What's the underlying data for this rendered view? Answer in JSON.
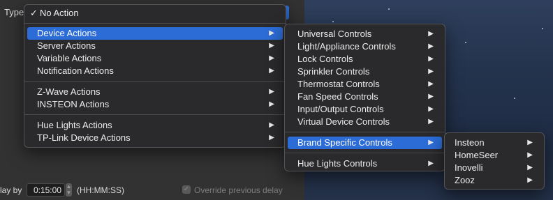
{
  "window": {
    "type_label": "Type",
    "delay_label": "lay by",
    "delay_value": "0:15:00",
    "delay_format": "(HH:MM:SS)",
    "override_label": "Override previous delay"
  },
  "main_menu": {
    "checked_item": "No Action",
    "check_glyph": "✓",
    "groups": [
      [
        "Device Actions",
        "Server Actions",
        "Variable Actions",
        "Notification Actions"
      ],
      [
        "Z-Wave Actions",
        "INSTEON Actions"
      ],
      [
        "Hue Lights Actions",
        "TP-Link Device Actions"
      ]
    ],
    "selected": "Device Actions"
  },
  "device_menu": {
    "groups": [
      [
        "Universal Controls",
        "Light/Appliance Controls",
        "Lock Controls",
        "Sprinkler Controls",
        "Thermostat Controls",
        "Fan Speed Controls",
        "Input/Output Controls",
        "Virtual Device Controls"
      ],
      [
        "Brand Specific Controls"
      ],
      [
        "Hue Lights Controls"
      ]
    ],
    "selected": "Brand Specific Controls"
  },
  "brand_menu": {
    "items": [
      "Insteon",
      "HomeSeer",
      "Inovelli",
      "Zooz"
    ]
  },
  "submenu_arrow": "▶",
  "colors": {
    "highlight": "#2c6cd6",
    "menu_bg": "#2a2a2c"
  }
}
